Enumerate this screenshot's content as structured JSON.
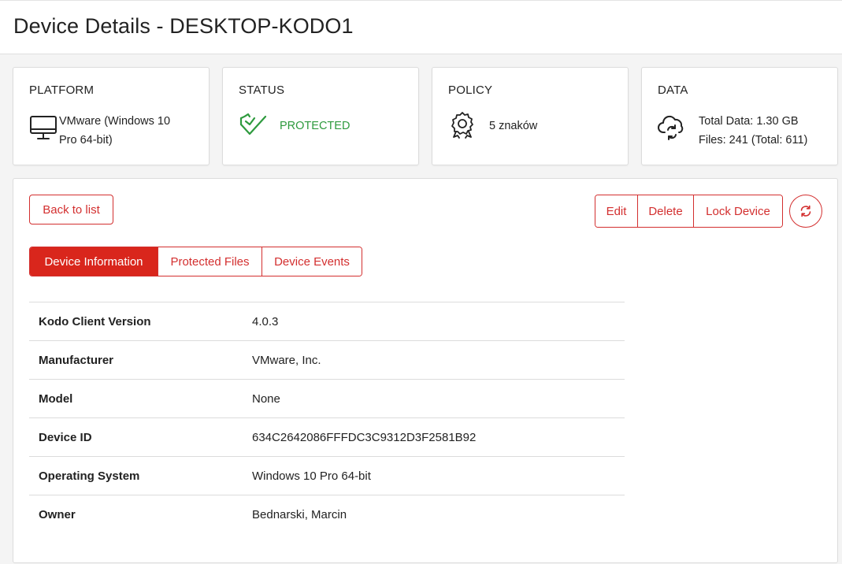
{
  "page": {
    "title": "Device Details - DESKTOP-KODO1"
  },
  "cards": {
    "platform": {
      "title": "PLATFORM",
      "line1": "VMware (Windows 10",
      "line2": "Pro 64-bit)",
      "icon": "desktop-monitor-icon"
    },
    "status": {
      "title": "STATUS",
      "value": "PROTECTED",
      "color": "#2e9a3e",
      "icon": "check-shield-icon"
    },
    "policy": {
      "title": "POLICY",
      "value": "5 znaków",
      "icon": "badge-icon"
    },
    "data": {
      "title": "DATA",
      "line1": "Total Data: 1.30 GB",
      "line2": "Files: 241 (Total: 611)",
      "icon": "cloud-sync-icon"
    }
  },
  "actions": {
    "back": "Back to list",
    "edit": "Edit",
    "delete": "Delete",
    "lock": "Lock Device",
    "refresh_icon": "refresh-icon"
  },
  "tabs": [
    {
      "label": "Device Information",
      "active": true
    },
    {
      "label": "Protected Files",
      "active": false
    },
    {
      "label": "Device Events",
      "active": false
    }
  ],
  "details": [
    {
      "key": "Kodo Client Version",
      "value": "4.0.3"
    },
    {
      "key": "Manufacturer",
      "value": "VMware, Inc."
    },
    {
      "key": "Model",
      "value": "None"
    },
    {
      "key": "Device ID",
      "value": "634C2642086FFFDC3C9312D3F2581B92"
    },
    {
      "key": "Operating System",
      "value": "Windows 10 Pro 64-bit"
    },
    {
      "key": "Owner",
      "value": "Bednarski, Marcin"
    }
  ],
  "colors": {
    "accent": "#d9261c",
    "success": "#2e9a3e"
  }
}
